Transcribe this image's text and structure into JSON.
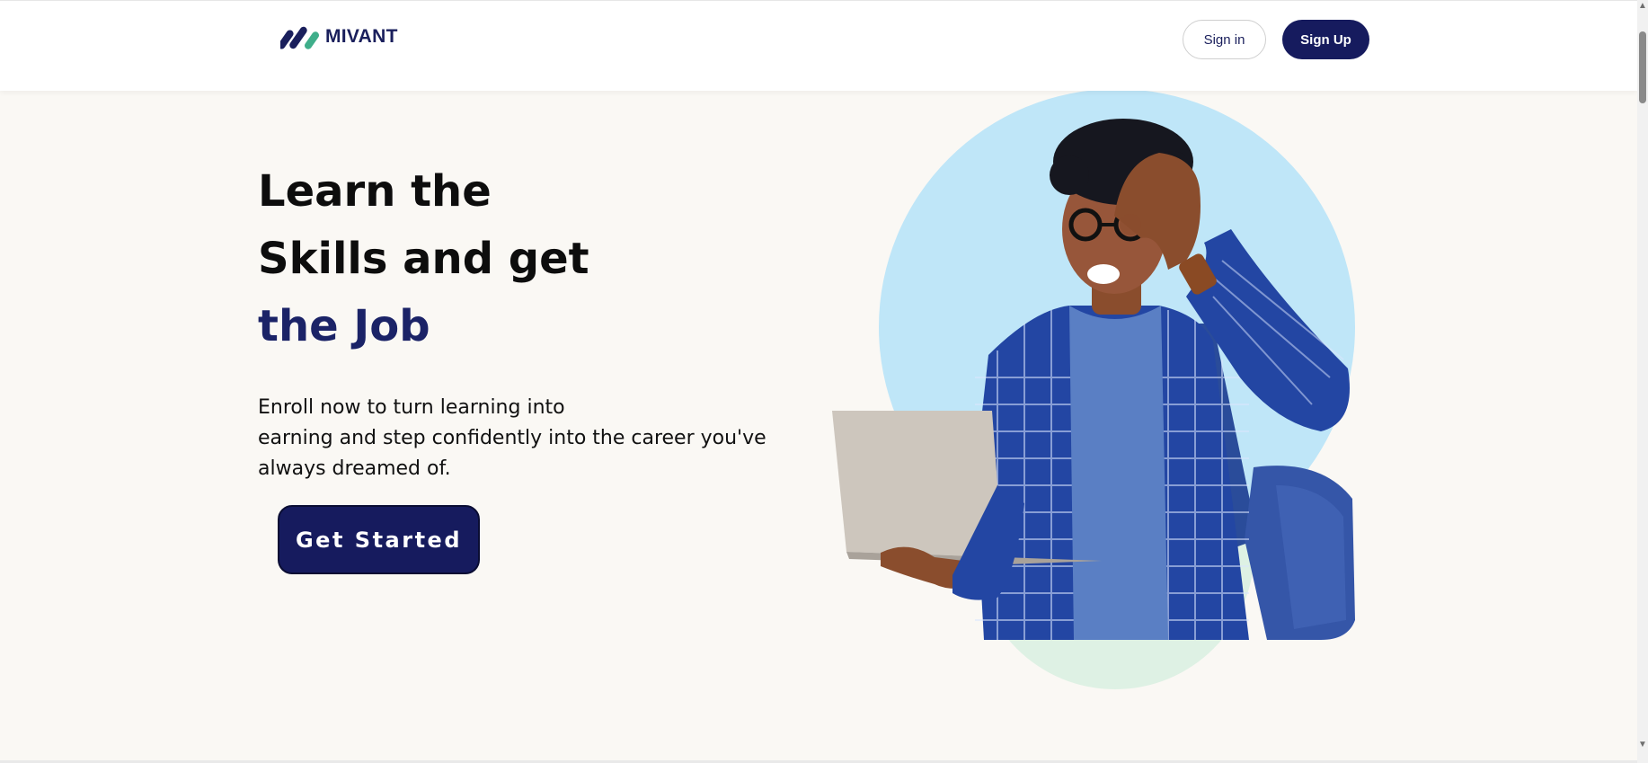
{
  "header": {
    "brand": "MIVANT",
    "signin_label": "Sign in",
    "signup_label": "Sign Up"
  },
  "hero": {
    "title_lines": [
      "Learn the",
      "Skills and get"
    ],
    "title_accent": "the Job",
    "description_lines": [
      "Enroll now to turn learning into",
      "earning and step confidently into the career you've",
      "always dreamed of."
    ],
    "cta_label": "Get Started"
  },
  "icons": {
    "logo": "mivant-logo-icon",
    "scroll_up": "scroll-up-arrow-icon",
    "scroll_down": "scroll-down-arrow-icon"
  },
  "colors": {
    "brand_navy": "#161b5e",
    "accent_text": "#1b2367",
    "page_bg": "#faf8f4",
    "circle_blue": "#bfe6f8",
    "circle_green": "#def1e4",
    "logo_green": "#3fae8a"
  }
}
